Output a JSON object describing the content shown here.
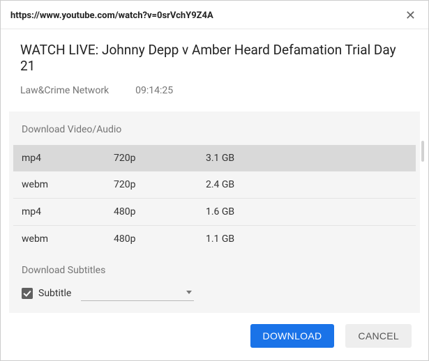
{
  "header": {
    "url": "https://www.youtube.com/watch?v=0srVchY9Z4A"
  },
  "video": {
    "title": "WATCH LIVE: Johnny Depp v Amber Heard Defamation Trial Day 21",
    "channel": "Law&Crime Network",
    "duration": "09:14:25"
  },
  "download_section_title": "Download Video/Audio",
  "formats": [
    {
      "format": "mp4",
      "quality": "720p",
      "size": "3.1 GB",
      "selected": true
    },
    {
      "format": "webm",
      "quality": "720p",
      "size": "2.4 GB",
      "selected": false
    },
    {
      "format": "mp4",
      "quality": "480p",
      "size": "1.6 GB",
      "selected": false
    },
    {
      "format": "webm",
      "quality": "480p",
      "size": "1.1 GB",
      "selected": false
    }
  ],
  "subtitles": {
    "section_title": "Download Subtitles",
    "checkbox_label": "Subtitle",
    "checked": true,
    "selected": ""
  },
  "buttons": {
    "download": "DOWNLOAD",
    "cancel": "CANCEL"
  }
}
